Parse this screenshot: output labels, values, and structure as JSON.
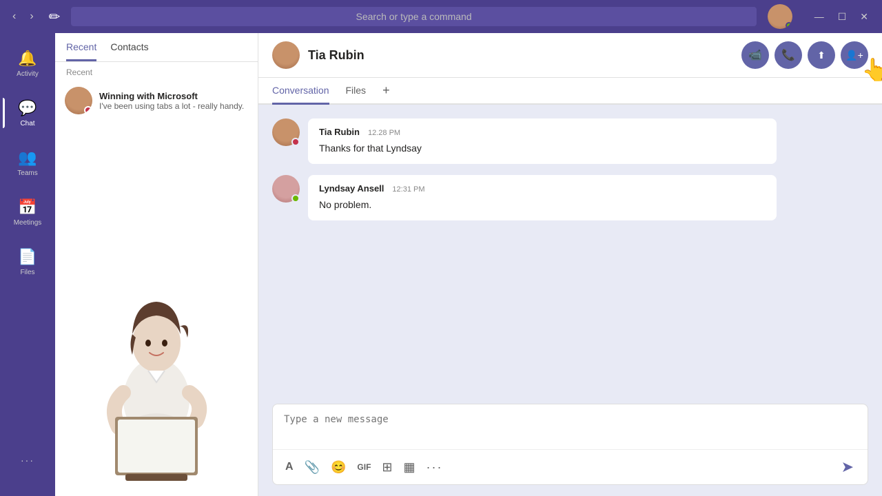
{
  "titlebar": {
    "search_placeholder": "Search or type a command",
    "nav_back": "‹",
    "nav_forward": "›",
    "compose_icon": "✏",
    "window_minimize": "—",
    "window_maximize": "☐",
    "window_close": "✕"
  },
  "sidebar": {
    "items": [
      {
        "id": "activity",
        "label": "Activity",
        "icon": "🔔",
        "active": false
      },
      {
        "id": "chat",
        "label": "Chat",
        "icon": "💬",
        "active": true
      },
      {
        "id": "teams",
        "label": "Teams",
        "icon": "👥",
        "active": false
      },
      {
        "id": "meetings",
        "label": "Meetings",
        "icon": "📅",
        "active": false
      },
      {
        "id": "files",
        "label": "Files",
        "icon": "📄",
        "active": false
      }
    ],
    "more_label": "...",
    "more_icon": "···"
  },
  "chat_panel": {
    "tabs": [
      {
        "id": "recent",
        "label": "Recent",
        "active": true
      },
      {
        "id": "contacts",
        "label": "Contacts",
        "active": false
      }
    ],
    "recent_label": "Recent",
    "items": [
      {
        "name": "Winning with Microsoft",
        "preview": "I've been using tabs a lot - really handy.",
        "status": "busy"
      }
    ]
  },
  "conversation": {
    "contact_name": "Tia Rubin",
    "tabs": [
      {
        "id": "conversation",
        "label": "Conversation",
        "active": true
      },
      {
        "id": "files",
        "label": "Files",
        "active": false
      }
    ],
    "add_tab_icon": "+",
    "messages": [
      {
        "sender": "Tia Rubin",
        "time": "12.28 PM",
        "text": "Thanks for that Lyndsay",
        "avatar_type": "tia",
        "status": "busy"
      },
      {
        "sender": "Lyndsay Ansell",
        "time": "12:31 PM",
        "text": "No problem.",
        "avatar_type": "lyndsay",
        "status": "online"
      }
    ],
    "compose_placeholder": "Type a new message",
    "toolbar": {
      "format_icon": "A",
      "attach_icon": "📎",
      "emoji_icon": "😊",
      "gif_icon": "GIF",
      "sticker_icon": "⊞",
      "meeting_icon": "▦",
      "more_icon": "···",
      "send_icon": "➤"
    },
    "action_buttons": {
      "video": "📹",
      "phone": "📞",
      "share": "⬆",
      "add_person": "👤+"
    }
  }
}
